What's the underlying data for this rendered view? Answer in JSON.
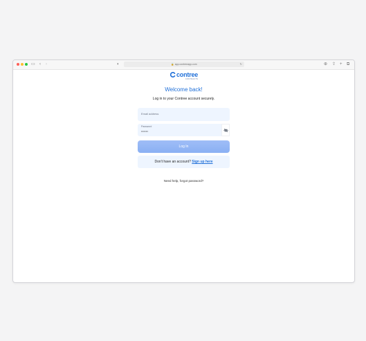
{
  "browser": {
    "url": "app.contreeapp.com",
    "icons": [
      "sidebar-icon",
      "back-icon",
      "forward-icon",
      "privacy-icon",
      "lock-icon",
      "reload-icon",
      "download-icon",
      "share-icon",
      "new-tab-icon",
      "tabs-icon"
    ]
  },
  "logo": {
    "name": "contree",
    "subtitle": "CONTRACTS"
  },
  "login": {
    "title": "Welcome back!",
    "subtitle": "Log in to your Contree account securely.",
    "email_placeholder": "Email address",
    "password_label": "Password",
    "password_value": "••••••",
    "login_button": "Log In",
    "signup_prompt": "Don't have an account?",
    "signup_link": "Sign up here",
    "help_link": "Need help, forgot password?"
  },
  "colors": {
    "accent": "#1f6fd8",
    "button": "#8ab0f3",
    "field_bg": "#eef5ff"
  }
}
